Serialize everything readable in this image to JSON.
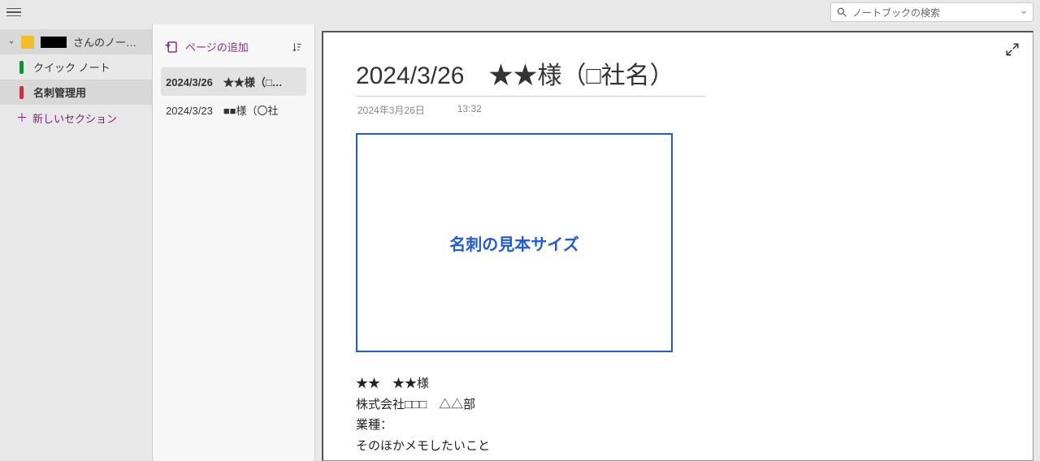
{
  "search": {
    "placeholder": "ノートブックの検索"
  },
  "sidebar": {
    "notebook_suffix": "さんのノートブック",
    "quick_notes": "クイック ノート",
    "card_section": "名刺管理用",
    "new_section": "新しいセクション"
  },
  "pagelist": {
    "add_page": "ページの追加",
    "items": [
      {
        "label": "2024/3/26　★★様（□…"
      },
      {
        "label": "2024/3/23　■■様（〇社"
      }
    ]
  },
  "page": {
    "title": "2024/3/26　★★様（□社名）",
    "date": "2024年3月26日",
    "time": "13:32",
    "card_placeholder": "名刺の見本サイズ",
    "body": {
      "line1": "★★　★★様",
      "line2": "株式会社□□□　△△部",
      "line3": "業種：",
      "line4": "そのほかメモしたいこと"
    }
  }
}
